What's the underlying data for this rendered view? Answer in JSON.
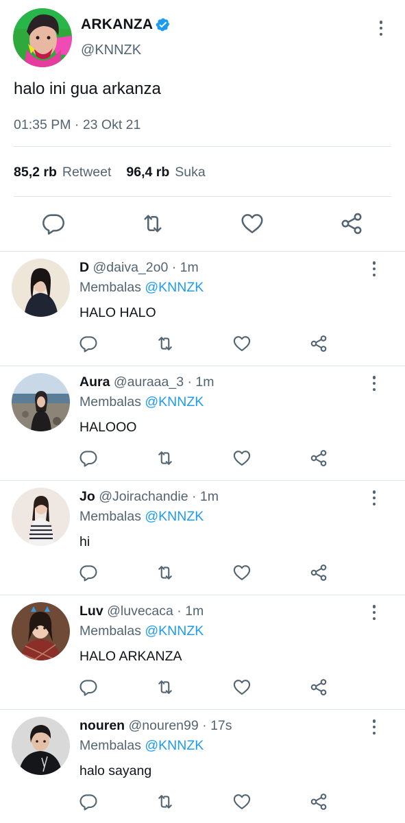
{
  "main_tweet": {
    "name": "ARKANZA",
    "handle": "@KNNZK",
    "text": "halo ini gua arkanza",
    "time": "01:35 PM",
    "separator": "·",
    "date": "23 Okt 21",
    "retweet_count": "85,2 rb",
    "retweet_label": "Retweet",
    "like_count": "96,4 rb",
    "like_label": "Suka"
  },
  "replies": [
    {
      "name": "D",
      "handle": "@daiva_2o0",
      "sep": "·",
      "time": "1m",
      "reply_label": "Membalas",
      "reply_to": "@KNNZK",
      "text": "HALO HALO"
    },
    {
      "name": "Aura",
      "handle": "@auraaa_3",
      "sep": "·",
      "time": "1m",
      "reply_label": "Membalas",
      "reply_to": "@KNNZK",
      "text": "HALOOO"
    },
    {
      "name": "Jo",
      "handle": "@Joirachandie",
      "sep": "·",
      "time": "1m",
      "reply_label": "Membalas",
      "reply_to": "@KNNZK",
      "text": "hi"
    },
    {
      "name": "Luv",
      "handle": "@luvecaca",
      "sep": "·",
      "time": "1m",
      "reply_label": "Membalas",
      "reply_to": "@KNNZK",
      "text": "HALO ARKANZA"
    },
    {
      "name": "nouren",
      "handle": "@nouren99",
      "sep": "·",
      "time": "17s",
      "reply_label": "Membalas",
      "reply_to": "@KNNZK",
      "text": "halo sayang"
    }
  ],
  "icons": {
    "reply": "reply-icon",
    "retweet": "retweet-icon",
    "like": "heart-icon",
    "share": "share-icon",
    "more": "more-icon",
    "verified": "verified-badge-icon"
  },
  "colors": {
    "text": "#0f1419",
    "secondary": "#536471",
    "accent": "#1d9bf0",
    "divider": "#dfe4e8"
  }
}
